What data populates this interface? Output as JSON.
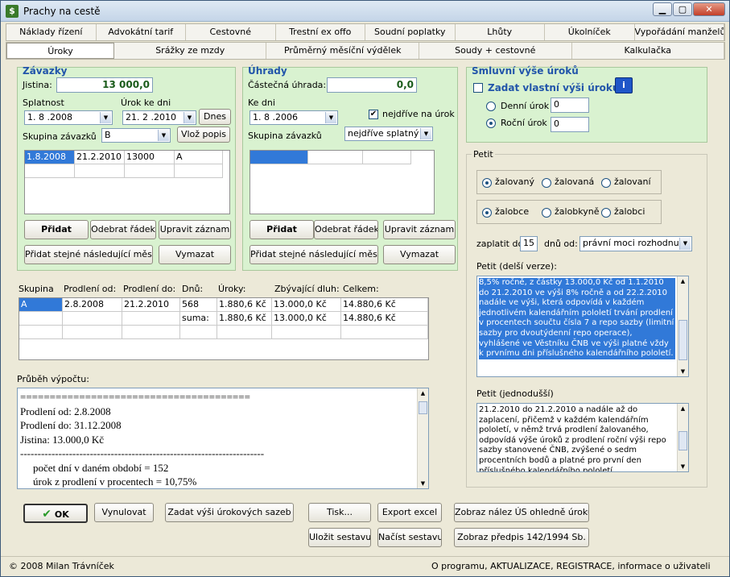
{
  "window": {
    "title": "Prachy na cestě",
    "icon": "app-money-icon"
  },
  "tabs_row1": [
    "Náklady řízení",
    "Advokátní tarif",
    "Cestovné",
    "Trestní ex offo",
    "Soudní poplatky",
    "Lhůty",
    "Úkolníček",
    "Vypořádání manželů"
  ],
  "tabs_row2": [
    "Úroky",
    "Srážky ze mzdy",
    "Průměrný měsíční výdělek",
    "Soudy + cestovné",
    "Kalkulačka"
  ],
  "zavazky": {
    "title": "Závazky",
    "jistina_label": "Jistina:",
    "jistina": "13 000,0",
    "splatnost_label": "Splatnost",
    "splatnost": "1. 8 .2008",
    "urok_label": "Úrok ke dni",
    "urok": "21. 2 .2010",
    "dnes": "Dnes",
    "skupina_label": "Skupina závazků",
    "skupina": "B",
    "vloz": "Vlož popis",
    "rows": [
      [
        "1.8.2008",
        "21.2.2010",
        "13000",
        "A"
      ]
    ],
    "pridat": "Přidat",
    "odebrat": "Odebrat řádek",
    "upravit": "Upravit záznam",
    "pridat_stejne": "Přidat stejné následující měsíc",
    "vymazat": "Vymazat"
  },
  "uhrady": {
    "title": "Úhrady",
    "castecna_label": "Částečná úhrada:",
    "castecna": "0,0",
    "kedni_label": "Ke dni",
    "kedni": "1. 8 .2006",
    "nejdrive_label": "nejdříve na úrok",
    "skupina_label": "Skupina závazků",
    "skupina": "nejdříve splatný",
    "pridat": "Přidat",
    "odebrat": "Odebrat řádek",
    "upravit": "Upravit záznam",
    "pridat_stejne": "Přidat stejné následující měsíc",
    "vymazat": "Vymazat"
  },
  "smluvni": {
    "title": "Smluvní výše úroků",
    "zadat_label": "Zadat vlastní výši úroku:",
    "denni_label": "Denní úrok",
    "denni": "0",
    "rocni_label": "Roční úrok",
    "rocni": "0"
  },
  "petit": {
    "title": "Petit",
    "opt1": [
      "žalovaný",
      "žalovaná",
      "žalovaní"
    ],
    "opt2": [
      "žalobce",
      "žalobkyně",
      "žalobci"
    ],
    "zaplatit_label": "zaplatit do",
    "zaplatit": "15",
    "dnu_label": "dnů od:",
    "dnu": "právní moci rozhodnutí",
    "delsi_label": "Petit (delší verze):",
    "delsi": "8,5% ročně, z částky 13.000,0 Kč od 1.1.2010 do 21.2.2010 ve výši 8% ročně a od 22.2.2010 nadále ve výši, která odpovídá v každém jednotlivém kalendářním pololetí trvání prodlení v procentech součtu čísla 7 a repo sazby (limitní sazby pro dvoutýdenní repo operace), vyhlášené ve Věstníku ČNB ve výši platné vždy k prvnímu dni příslušného kalendářního pololetí.",
    "jednodussi_label": "Petit (jednodušší)",
    "jednodussi": "21.2.2010 do 21.2.2010 a nadále až do zaplacení, přičemž v každém kalendářním pololetí, v němž trvá prodlení žalovaného, odpovídá výše úroků z prodlení roční výši repo sazby stanovené ČNB, zvýšené o sedm procentních bodů a platné pro první den příslušného kalendářního pololetí."
  },
  "results": {
    "headers": [
      "Skupina",
      "Prodlení od:",
      "Prodlení do:",
      "Dnů:",
      "Úroky:",
      "Zbývající dluh:",
      "Celkem:"
    ],
    "rows": [
      [
        "A",
        "2.8.2008",
        "21.2.2010",
        "568",
        "1.880,6 Kč",
        "13.000,0 Kč",
        "14.880,6 Kč"
      ],
      [
        "",
        "",
        "",
        "suma:",
        "1.880,6 Kč",
        "13.000,0 Kč",
        "14.880,6 Kč"
      ]
    ]
  },
  "prubeh": {
    "label": "Průběh výpočtu:",
    "lines": [
      "=======================================",
      "Prodlení od: 2.8.2008",
      "Prodlení do: 31.12.2008",
      "Jistina: 13.000,0 Kč",
      "----------------------------------------------------------------------",
      "počet dní v daném období = 152",
      "úrok z prodlení v procentech = 10,75%"
    ]
  },
  "buttons": {
    "ok": "OK",
    "vynulovat": "Vynulovat",
    "zadat": "Zadat výši úrokových sazeb",
    "tisk": "Tisk...",
    "export": "Export excel",
    "nalez": "Zobraz nález ÚS ohledně úroků",
    "ulozit": "Uložit sestavu",
    "nacist": "Načíst sestavu",
    "predpis": "Zobraz předpis 142/1994 Sb."
  },
  "status": {
    "left": "© 2008 Milan Trávníček",
    "right": "O programu, AKTUALIZACE, REGISTRACE, informace o uživateli"
  },
  "colors": {
    "panel": "#d9f2d0",
    "selection": "#3179d8",
    "bold_blue": "#2255aa"
  }
}
